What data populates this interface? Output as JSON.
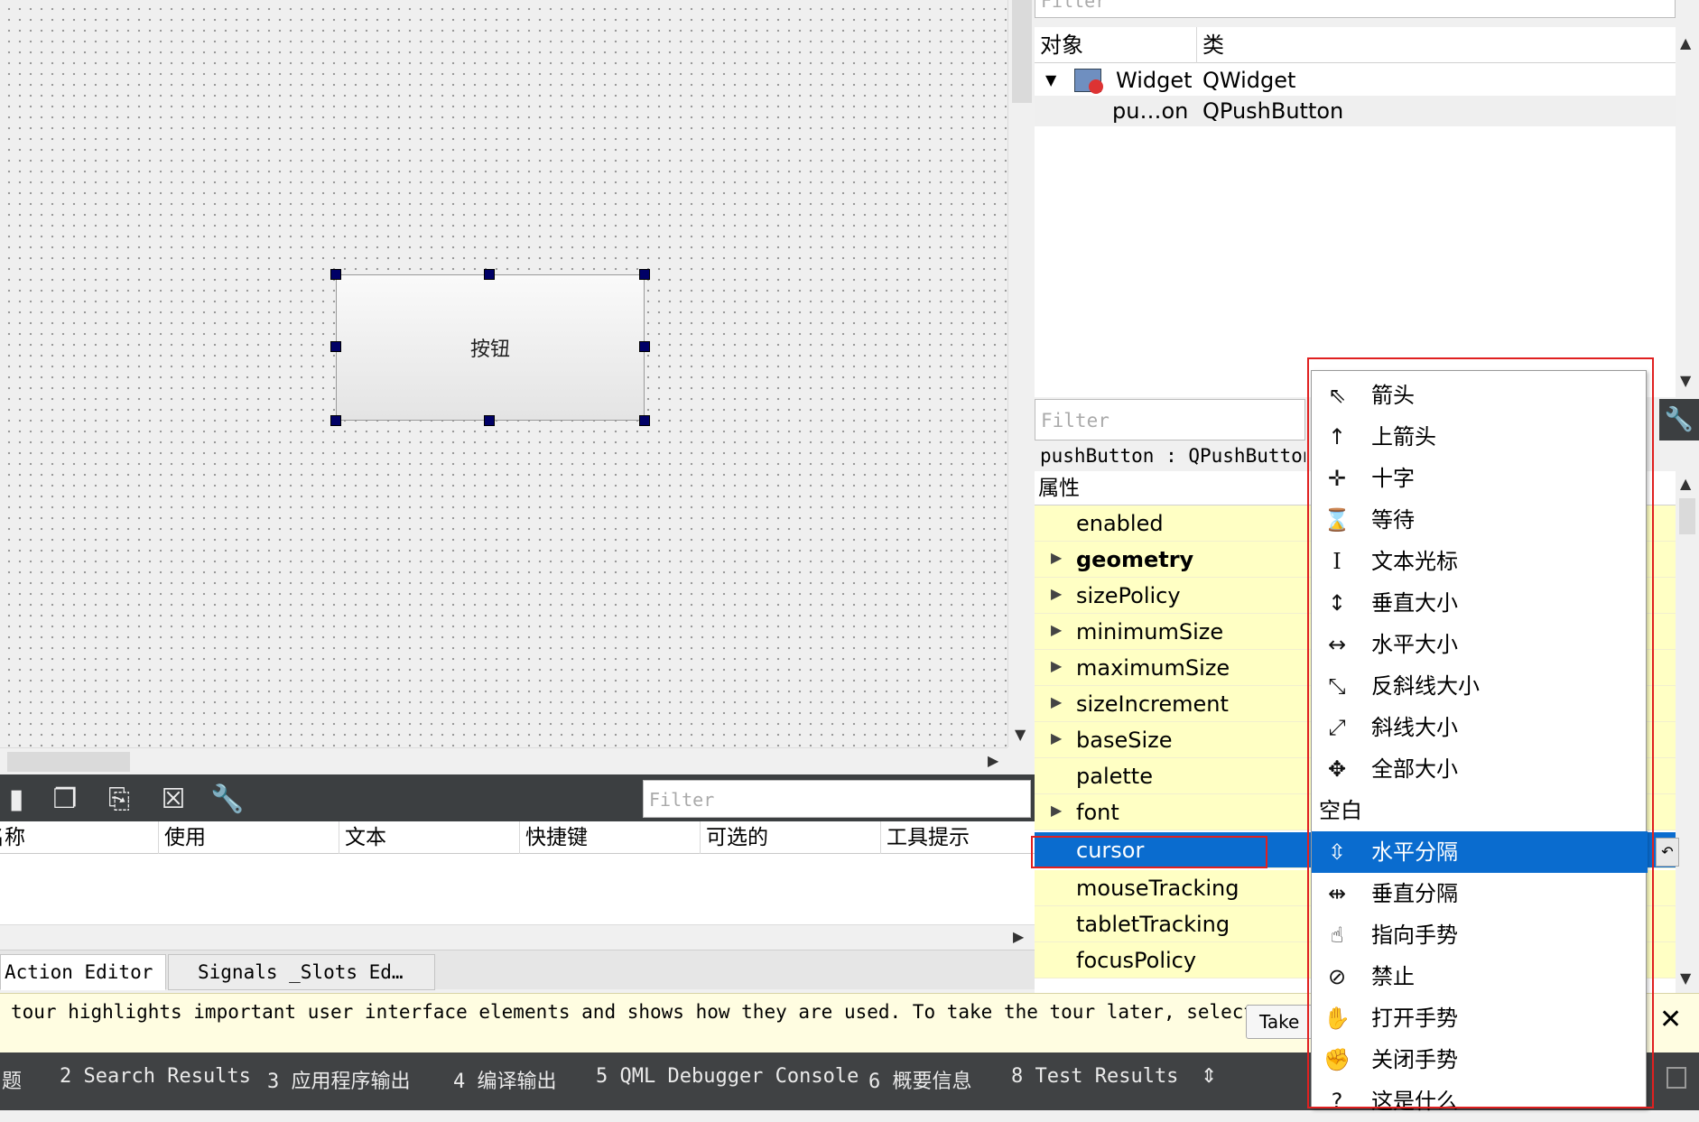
{
  "canvas": {
    "push_button_text": "按钮"
  },
  "action_editor": {
    "filter_placeholder": "Filter",
    "columns": [
      "名称",
      "使用",
      "文本",
      "快捷键",
      "可选的",
      "工具提示"
    ],
    "tabs": [
      "Action Editor",
      "Signals _Slots Ed…"
    ]
  },
  "object_inspector": {
    "filter_placeholder": "Filter",
    "columns": [
      "对象",
      "类"
    ],
    "rows": [
      {
        "object": "Widget",
        "class": "QWidget",
        "expanded": true
      },
      {
        "object": "pu…on",
        "class": "QPushButton"
      }
    ]
  },
  "property_editor": {
    "filter_placeholder": "Filter",
    "object_line": "pushButton : QPushButton",
    "header": "属性",
    "properties": [
      {
        "name": "enabled",
        "expandable": false,
        "bold": false
      },
      {
        "name": "geometry",
        "expandable": true,
        "bold": true
      },
      {
        "name": "sizePolicy",
        "expandable": true,
        "bold": false
      },
      {
        "name": "minimumSize",
        "expandable": true,
        "bold": false
      },
      {
        "name": "maximumSize",
        "expandable": true,
        "bold": false
      },
      {
        "name": "sizeIncrement",
        "expandable": true,
        "bold": false
      },
      {
        "name": "baseSize",
        "expandable": true,
        "bold": false
      },
      {
        "name": "palette",
        "expandable": false,
        "bold": false
      },
      {
        "name": "font",
        "expandable": true,
        "bold": false
      },
      {
        "name": "cursor",
        "expandable": false,
        "bold": false,
        "selected": true
      },
      {
        "name": "mouseTracking",
        "expandable": false,
        "bold": false
      },
      {
        "name": "tabletTracking",
        "expandable": false,
        "bold": false
      },
      {
        "name": "focusPolicy",
        "expandable": false,
        "bold": false
      }
    ]
  },
  "cursor_dropdown": {
    "selected": "水平分隔",
    "items": [
      {
        "label": "箭头",
        "icon": "arrow-cursor-icon",
        "glyph": "⇖"
      },
      {
        "label": "上箭头",
        "icon": "up-arrow-cursor-icon",
        "glyph": "↑"
      },
      {
        "label": "十字",
        "icon": "cross-cursor-icon",
        "glyph": "✛"
      },
      {
        "label": "等待",
        "icon": "hourglass-cursor-icon",
        "glyph": "⌛"
      },
      {
        "label": "文本光标",
        "icon": "ibeam-cursor-icon",
        "glyph": "I"
      },
      {
        "label": "垂直大小",
        "icon": "vertical-resize-cursor-icon",
        "glyph": "↕"
      },
      {
        "label": "水平大小",
        "icon": "horizontal-resize-cursor-icon",
        "glyph": "↔"
      },
      {
        "label": "反斜线大小",
        "icon": "bdiag-resize-cursor-icon",
        "glyph": "⤡"
      },
      {
        "label": "斜线大小",
        "icon": "fdiag-resize-cursor-icon",
        "glyph": "⤢"
      },
      {
        "label": "全部大小",
        "icon": "all-resize-cursor-icon",
        "glyph": "✥"
      },
      {
        "label": "空白",
        "icon": "",
        "glyph": ""
      },
      {
        "label": "水平分隔",
        "icon": "split-vertical-cursor-icon",
        "glyph": "⇳"
      },
      {
        "label": "垂直分隔",
        "icon": "split-horizontal-cursor-icon",
        "glyph": "⇹"
      },
      {
        "label": "指向手势",
        "icon": "pointing-hand-cursor-icon",
        "glyph": "☝"
      },
      {
        "label": "禁止",
        "icon": "forbidden-cursor-icon",
        "glyph": "⊘"
      },
      {
        "label": "打开手势",
        "icon": "open-hand-cursor-icon",
        "glyph": "✋"
      },
      {
        "label": "关闭手势",
        "icon": "closed-hand-cursor-icon",
        "glyph": "✊"
      },
      {
        "label": "这是什么",
        "icon": "whats-this-cursor-icon",
        "glyph": "?"
      }
    ]
  },
  "tour": {
    "text": "tour highlights important user interface elements and shows how they are used. To take the tour later, select",
    "take_button": "Take"
  },
  "output_bar": {
    "items": [
      "问题",
      "2 Search Results",
      "3 应用程序输出",
      "4 编译输出",
      "5 QML Debugger Console",
      "6 概要信息",
      "8 Test Results"
    ]
  },
  "colors": {
    "selection": "#0a6ccf",
    "property_row": "#ffffc4",
    "highlight_box": "#e02020",
    "handle": "#000066"
  }
}
